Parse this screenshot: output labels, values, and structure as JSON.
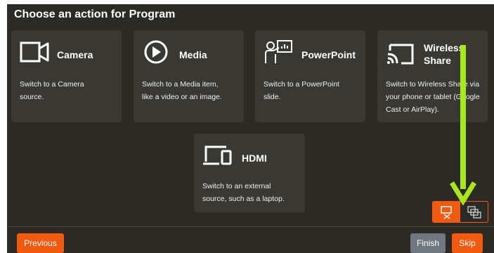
{
  "title": "Choose an action for Program",
  "cards": [
    {
      "name": "Camera",
      "desc": "Switch to a Camera source.",
      "icon": "camera-icon"
    },
    {
      "name": "Media",
      "desc": "Switch to a Media item, like a video or an image.",
      "icon": "play-icon"
    },
    {
      "name": "PowerPoint",
      "desc": "Switch to a PowerPoint slide.",
      "icon": "presenter-icon"
    },
    {
      "name": "Wireless Share",
      "desc": "Switch to Wireless Share via your phone or tablet (Google Cast or AirPlay).",
      "icon": "cast-icon"
    },
    {
      "name": "HDMI",
      "desc": "Switch to an external source, such as a laptop.",
      "icon": "devices-icon"
    }
  ],
  "buttons": {
    "previous": "Previous",
    "finish": "Finish",
    "skip": "Skip"
  },
  "toggle": {
    "left_icon": "cut-transition-icon",
    "right_icon": "overlay-transition-icon"
  },
  "colors": {
    "background": "#2c2a25",
    "card": "#3a3832",
    "accent": "#f25a10",
    "finish": "#6f7780",
    "annotation_arrow": "#a8e61d"
  }
}
